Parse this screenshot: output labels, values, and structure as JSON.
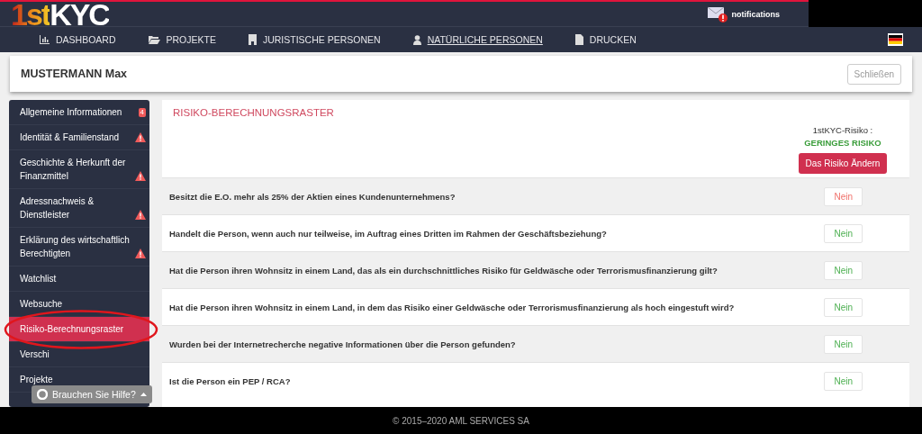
{
  "header": {
    "logo": "1stKYC",
    "notifications": "notifications"
  },
  "nav": [
    {
      "label": "DASHBOARD",
      "selected": false
    },
    {
      "label": "PROJEKTE",
      "selected": false
    },
    {
      "label": "JURISTISCHE PERSONEN",
      "selected": false
    },
    {
      "label": "NATÜRLICHE PERSONEN",
      "selected": true
    },
    {
      "label": "DRUCKEN",
      "selected": false
    }
  ],
  "person": {
    "name": "MUSTERMANN Max",
    "close_button": "Schließen"
  },
  "sidebar": {
    "items": [
      {
        "label": "Allgemeine Informationen",
        "badge": "4",
        "warning": false,
        "selected": false
      },
      {
        "label": "Identität & Familienstand",
        "warning": true,
        "selected": false
      },
      {
        "label": "Geschichte & Herkunft der Finanzmittel",
        "warning": true,
        "selected": false
      },
      {
        "label": "Adressnachweis & Dienstleister",
        "warning": true,
        "selected": false
      },
      {
        "label": "Erklärung des wirtschaftlich Berechtigten",
        "warning": true,
        "selected": false
      },
      {
        "label": "Watchlist",
        "warning": false,
        "selected": false
      },
      {
        "label": "Websuche",
        "warning": false,
        "selected": false
      },
      {
        "label": "Risiko-Berechnungsraster",
        "warning": false,
        "selected": true
      },
      {
        "label": "Verschi",
        "warning": false,
        "selected": false
      },
      {
        "label": "Projekte",
        "warning": false,
        "selected": false
      }
    ]
  },
  "help_button": "Brauchen Sie Hilfe?",
  "panel": {
    "title": "RISIKO-BERECHNUNGSRASTER",
    "risk_label": "1stKYC-Risiko :",
    "risk_value": "GERINGES RISIKO",
    "change_button": "Das Risiko Ändern",
    "questions": [
      {
        "text": "Besitzt die E.O. mehr als 25% der Aktien eines Kundenunternehmens?",
        "answer": "Nein",
        "flagged": true
      },
      {
        "text": "Handelt die Person, wenn auch nur teilweise, im Auftrag eines Dritten im Rahmen der Geschäftsbeziehung?",
        "answer": "Nein",
        "flagged": false
      },
      {
        "text": "Hat die Person ihren Wohnsitz in einem Land, das als ein durchschnittliches Risiko für Geldwäsche oder Terrorismusfinanzierung gilt?",
        "answer": "Nein",
        "flagged": false
      },
      {
        "text": "Hat die Person ihren Wohnsitz in einem Land, in dem das Risiko einer Geldwäsche oder Terrorismusfinanzierung als hoch eingestuft wird?",
        "answer": "Nein",
        "flagged": false
      },
      {
        "text": "Wurden bei der Internetrecherche negative Informationen über die Person gefunden?",
        "answer": "Nein",
        "flagged": false
      },
      {
        "text": "Ist die Person ein PEP / RCA?",
        "answer": "Nein",
        "flagged": false
      }
    ]
  },
  "footer": "© 2015–2020 AML SERVICES SA"
}
